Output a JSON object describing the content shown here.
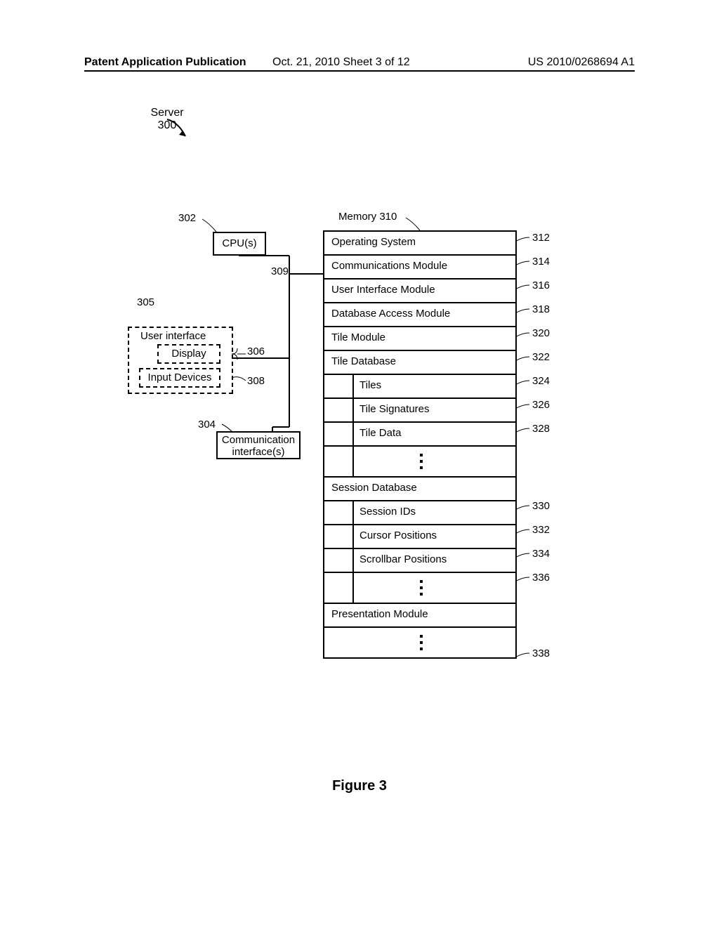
{
  "header": {
    "left": "Patent Application Publication",
    "mid": "Oct. 21, 2010  Sheet 3 of 12",
    "right": "US 2010/0268694 A1"
  },
  "server": {
    "label": "Server",
    "number": "300"
  },
  "refs": {
    "r302": "302",
    "r304": "304",
    "r305": "305",
    "r306": "306",
    "r308": "308",
    "r309": "309",
    "r312": "312",
    "r314": "314",
    "r316": "316",
    "r318": "318",
    "r320": "320",
    "r322": "322",
    "r324": "324",
    "r326": "326",
    "r328": "328",
    "r330": "330",
    "r332": "332",
    "r334": "334",
    "r336": "336",
    "r338": "338"
  },
  "left": {
    "cpu": "CPU(s)",
    "ui_label": "User interface",
    "display": "Display",
    "input": "Input Devices",
    "comm1": "Communication",
    "comm2": "interface(s)"
  },
  "memory": {
    "label": "Memory 310",
    "rows": {
      "os": "Operating System",
      "comm": "Communications Module",
      "uim": "User Interface Module",
      "dbacc": "Database Access Module",
      "tilemod": "Tile Module",
      "tiledb": "Tile Database",
      "tiles": "Tiles",
      "tilesig": "Tile Signatures",
      "tiledata": "Tile Data",
      "sessdb": "Session Database",
      "sessids": "Session IDs",
      "cursor": "Cursor Positions",
      "scroll": "Scrollbar Positions",
      "pres": "Presentation Module"
    }
  },
  "figure": "Figure 3"
}
